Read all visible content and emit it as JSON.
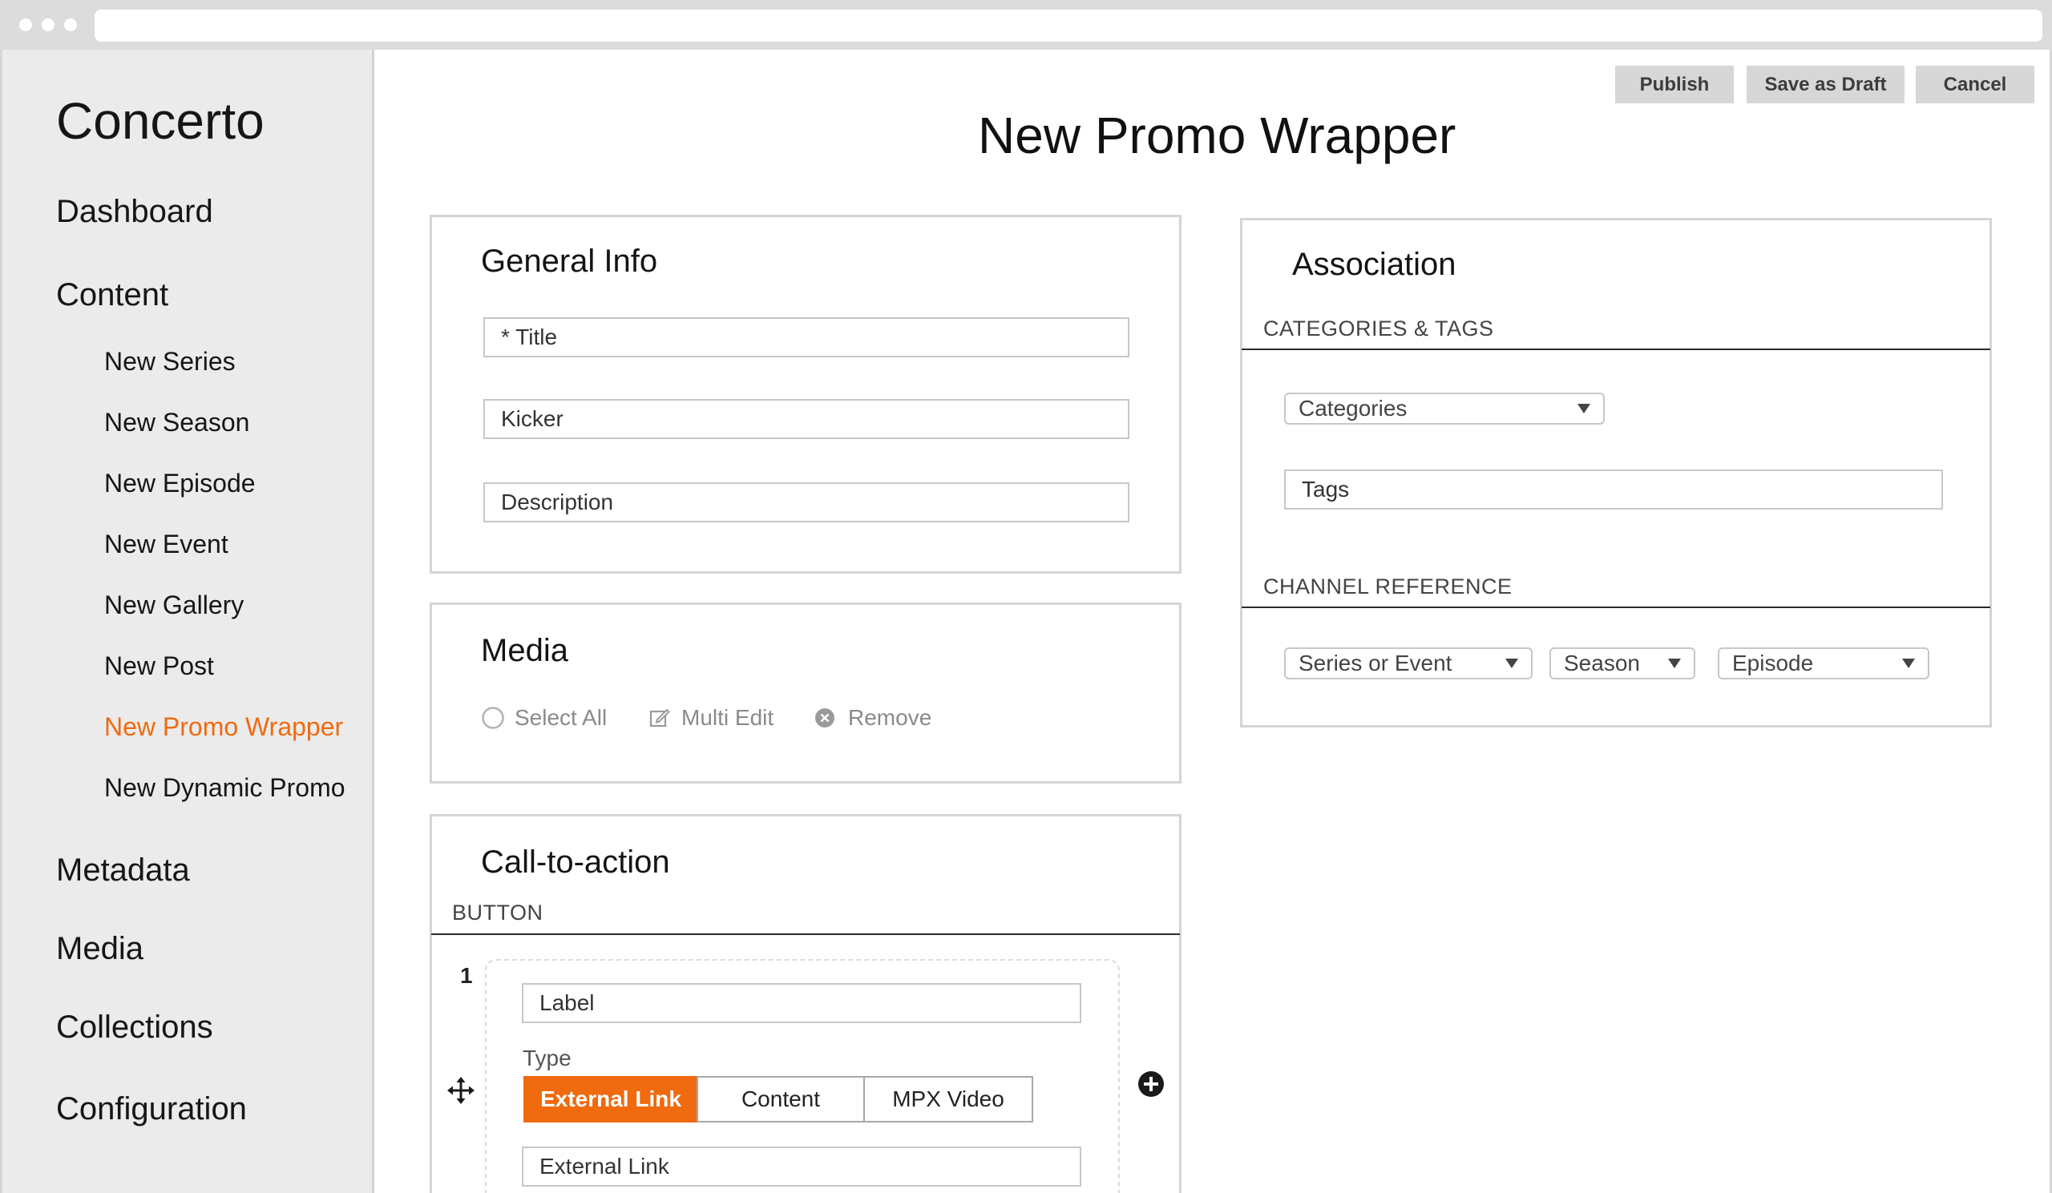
{
  "app": {
    "brand": "Concerto"
  },
  "sidebar": {
    "dashboard": "Dashboard",
    "content": "Content",
    "content_items": [
      {
        "label": "New Series"
      },
      {
        "label": "New Season"
      },
      {
        "label": "New Episode"
      },
      {
        "label": "New Event"
      },
      {
        "label": "New Gallery"
      },
      {
        "label": "New Post"
      },
      {
        "label": "New Promo Wrapper",
        "active": true
      },
      {
        "label": "New Dynamic Promo"
      }
    ],
    "metadata": "Metadata",
    "media": "Media",
    "collections": "Collections",
    "configuration": "Configuration"
  },
  "header": {
    "title": "New Promo Wrapper",
    "publish_label": "Publish",
    "save_draft_label": "Save as Draft",
    "cancel_label": "Cancel"
  },
  "general_info": {
    "title": "General Info",
    "title_placeholder": "* Title",
    "kicker_placeholder": "Kicker",
    "description_placeholder": "Description"
  },
  "media": {
    "title": "Media",
    "select_all": "Select All",
    "multi_edit": "Multi Edit",
    "remove": "Remove"
  },
  "cta": {
    "title": "Call-to-action",
    "section": "BUTTON",
    "index": "1",
    "label_placeholder": "Label",
    "type_label": "Type",
    "type_options": [
      "External Link",
      "Content",
      "MPX Video"
    ],
    "selected_type": "External Link",
    "external_link_placeholder": "External Link"
  },
  "association": {
    "title": "Association",
    "categories_section": "CATEGORIES & TAGS",
    "categories_select": "Categories",
    "tags_placeholder": "Tags",
    "channel_section": "CHANNEL REFERENCE",
    "series_select": "Series or Event",
    "season_select": "Season",
    "episode_select": "Episode"
  },
  "colors": {
    "accent": "#f06a0f",
    "sidebar_bg": "#ebebeb",
    "button_bg": "#d7d7d7",
    "panel_border": "#d4d4d4"
  },
  "icons": {
    "select_all": "radio-circle-icon",
    "multi_edit": "edit-icon",
    "remove": "remove-circle-icon",
    "drag": "move-arrows-icon",
    "add": "plus-circle-icon",
    "dropdown": "caret-down-icon"
  }
}
